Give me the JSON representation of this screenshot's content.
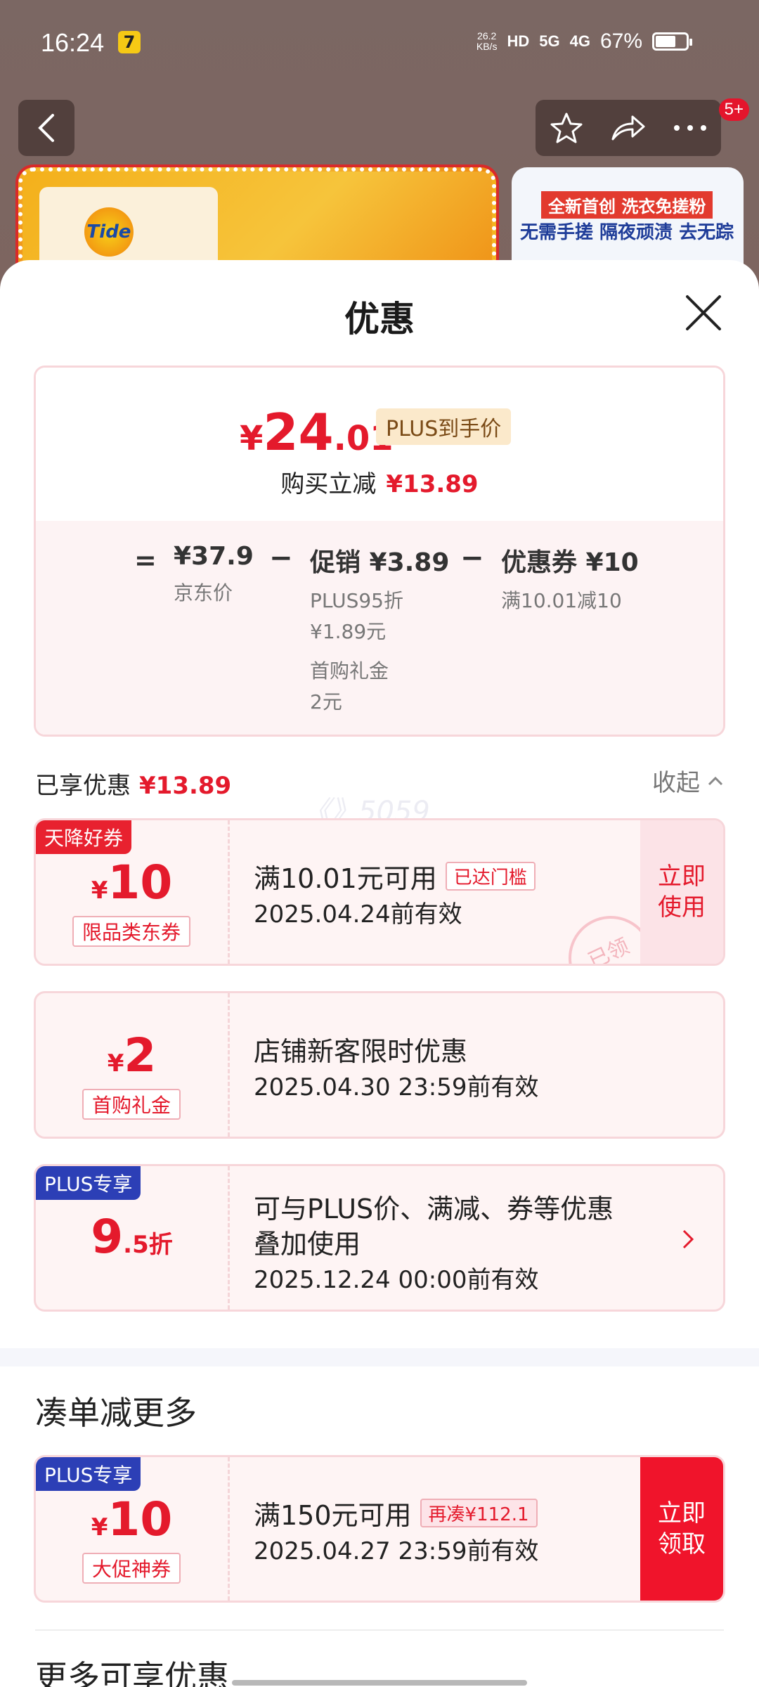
{
  "status_bar": {
    "time": "16:24",
    "app_badge": "7",
    "net_speed": "26.2",
    "net_unit": "KB/s",
    "hd": "HD",
    "sim1": "5G",
    "sim2": "4G",
    "battery": "67%",
    "battery_level": 0.67
  },
  "nav": {
    "badge": "5+"
  },
  "product": {
    "logo": "Tide",
    "side_tag1": "全新首创 洗衣免搓粉",
    "side_tag2": "无需手搓 隔夜顽渍 去无踪"
  },
  "sheet": {
    "title": "优惠"
  },
  "price": {
    "yen": "¥",
    "int": "24",
    "dec": ".01",
    "plus_tag": "PLUS到手价",
    "sub_label": "购买立减",
    "sub_value": "¥13.89",
    "eq": "=",
    "jd_price": "¥37.9",
    "jd_label": "京东价",
    "minus": "−",
    "promo_head": "促销 ¥3.89",
    "promo_note1": "PLUS95折",
    "promo_note2": "¥1.89元",
    "promo_note3": "首购礼金",
    "promo_note4": "2元",
    "coupon_head": "优惠券 ¥10",
    "coupon_note": "满10.01减10"
  },
  "enjoyed": {
    "label": "已享优惠",
    "value": "¥13.89",
    "collapse": "收起"
  },
  "watermark": "《》5059",
  "coupons": [
    {
      "corner": "天降好券",
      "yen": "¥",
      "amount": "10",
      "type": "限品类东券",
      "main": "满10.01元可用",
      "tag": "已达门槛",
      "date": "2025.04.24前有效",
      "action": "立即使用",
      "stamp": "已领"
    },
    {
      "yen": "¥",
      "amount": "2",
      "type": "首购礼金",
      "main": "店铺新客限时优惠",
      "date": "2025.04.30 23:59前有效"
    },
    {
      "corner": "PLUS专享",
      "amount": "9",
      "small": ".5折",
      "main_line1": "可与PLUS价、满减、券等优惠",
      "main_line2": "叠加使用",
      "date": "2025.12.24 00:00前有效"
    }
  ],
  "more_section": {
    "title": "凑单减更多",
    "coupon": {
      "corner": "PLUS专享",
      "yen": "¥",
      "amount": "10",
      "type": "大促神券",
      "main": "满150元可用",
      "tag": "再凑¥112.1",
      "date": "2025.04.27 23:59前有效",
      "action": "立即领取"
    }
  },
  "more_benefits": {
    "title": "更多可享优惠"
  },
  "colors": {
    "accent_red": "#e41a2c",
    "plus_blue": "#2c3fb6",
    "claim_red": "#f0142b"
  }
}
